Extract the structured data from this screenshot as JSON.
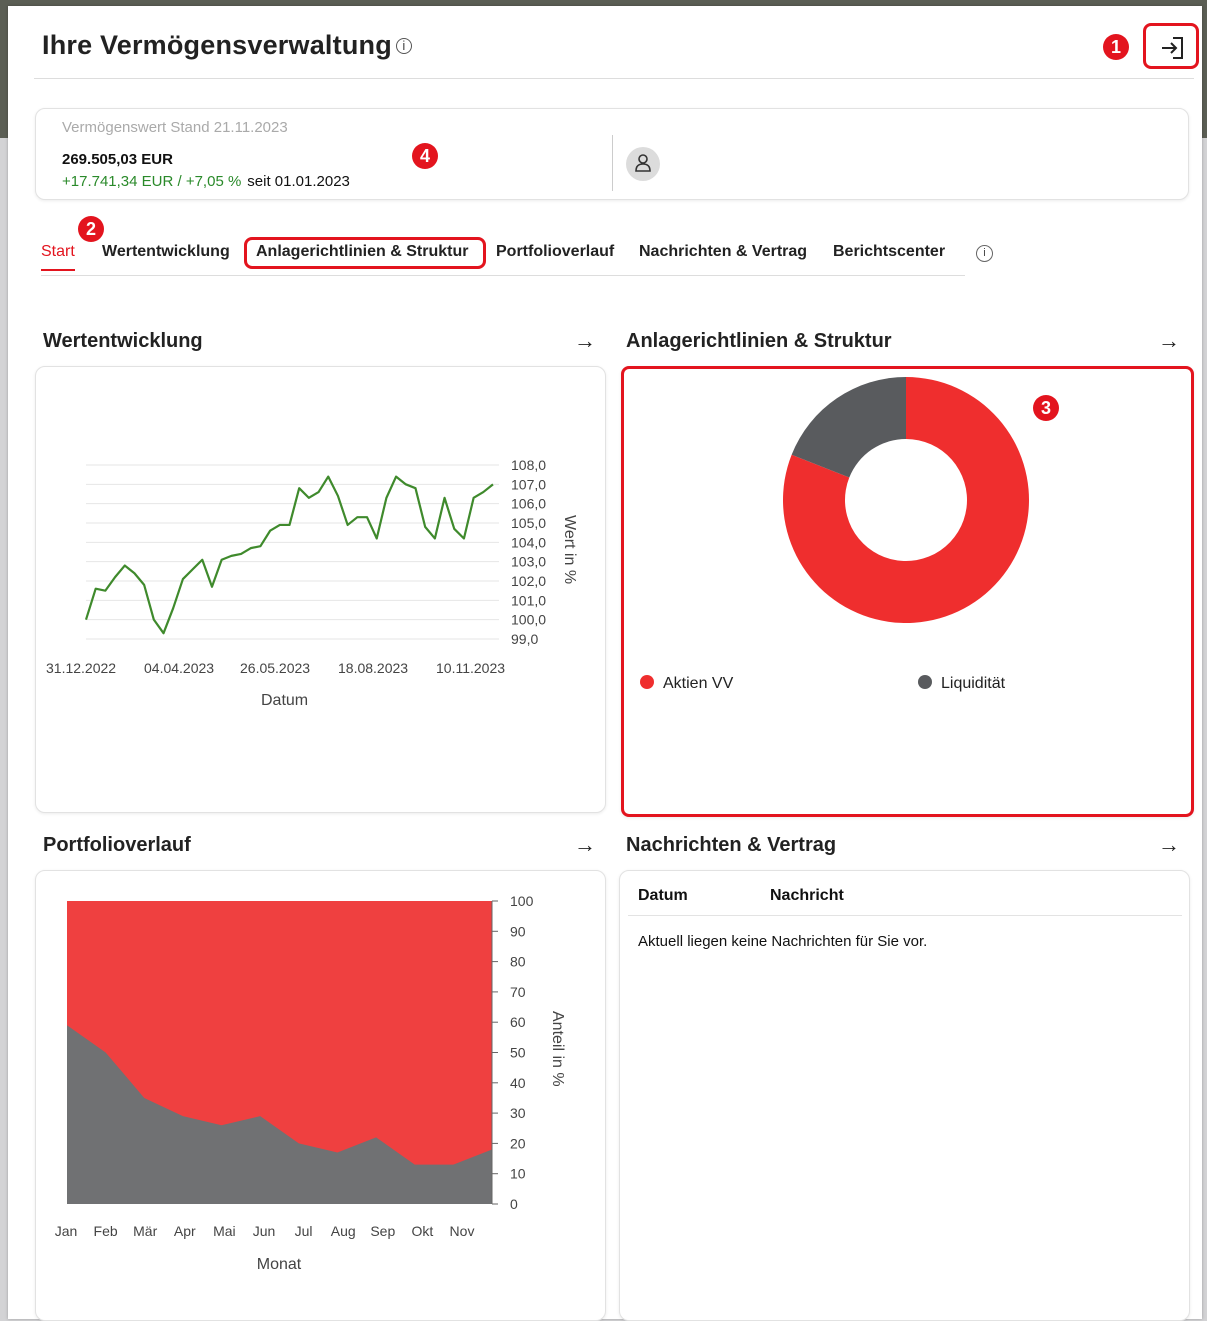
{
  "header": {
    "title": "Ihre Vermögensverwaltung",
    "info_icon": "info-circle-icon",
    "logout_icon": "exit-icon"
  },
  "markers": [
    "1",
    "2",
    "3",
    "4"
  ],
  "asset": {
    "label": "Vermögenswert Stand 21.11.2023",
    "value": "269.505,03 EUR",
    "change": "+17.741,34 EUR / +7,05 %",
    "since": "seit 01.01.2023",
    "avatar_icon": "user-icon"
  },
  "tabs": [
    "Start",
    "Wertentwicklung",
    "Anlagerichtlinien & Struktur",
    "Portfolioverlauf",
    "Nachrichten & Vertrag",
    "Berichtscenter"
  ],
  "active_tab": "Start",
  "colors": {
    "accent": "#e3141e",
    "positive": "#2a8a2a",
    "line": "#3f8a2c",
    "aktien": "#ef2e2e",
    "liquiditaet": "#595b5e"
  },
  "sections": {
    "wertentwicklung": "Wertentwicklung",
    "anlage": "Anlagerichtlinien & Struktur",
    "portfolio": "Portfolioverlauf",
    "nachrichten": "Nachrichten & Vertrag"
  },
  "chart_data": [
    {
      "type": "line",
      "xlabel": "Datum",
      "ylabel": "Wert in %",
      "x_ticks": [
        "31.12.2022",
        "04.04.2023",
        "26.05.2023",
        "18.08.2023",
        "10.11.2023"
      ],
      "y_ticks": [
        "108,0",
        "107,0",
        "106,0",
        "105,0",
        "104,0",
        "103,0",
        "102,0",
        "101,0",
        "100,0",
        "99,0"
      ],
      "ylim": [
        99,
        108
      ],
      "values": [
        100.0,
        101.6,
        101.5,
        102.2,
        102.8,
        102.4,
        101.8,
        100.0,
        99.3,
        100.6,
        102.1,
        102.6,
        103.1,
        101.7,
        103.1,
        103.3,
        103.4,
        103.7,
        103.8,
        104.6,
        104.9,
        104.9,
        106.8,
        106.3,
        106.6,
        107.4,
        106.4,
        104.9,
        105.3,
        105.3,
        104.2,
        106.3,
        107.4,
        107.0,
        106.8,
        104.8,
        104.2,
        106.3,
        104.7,
        104.2,
        106.3,
        106.6,
        107.0
      ],
      "grid": true
    },
    {
      "type": "pie",
      "labels": [
        "Aktien VV",
        "Liquidität"
      ],
      "values": [
        81,
        19
      ],
      "donut": true,
      "legend": "bottom"
    },
    {
      "type": "area",
      "xlabel": "Monat",
      "ylabel": "Anteil in %",
      "categories": [
        "Jan",
        "Feb",
        "Mär",
        "Apr",
        "Mai",
        "Jun",
        "Jul",
        "Aug",
        "Sep",
        "Okt",
        "Nov"
      ],
      "y_ticks": [
        "100",
        "90",
        "80",
        "70",
        "60",
        "50",
        "40",
        "30",
        "20",
        "10",
        "0"
      ],
      "ylim": [
        0,
        100
      ],
      "stacked": true,
      "series": [
        {
          "values": [
            59,
            50,
            35,
            29,
            26,
            29,
            20,
            17,
            22,
            13,
            13,
            18
          ]
        },
        {
          "values": [
            41,
            50,
            65,
            71,
            74,
            71,
            80,
            83,
            78,
            87,
            87,
            82
          ]
        }
      ]
    }
  ],
  "messages": {
    "col_date": "Datum",
    "col_message": "Nachricht",
    "empty": "Aktuell liegen keine Nachrichten für Sie vor."
  }
}
